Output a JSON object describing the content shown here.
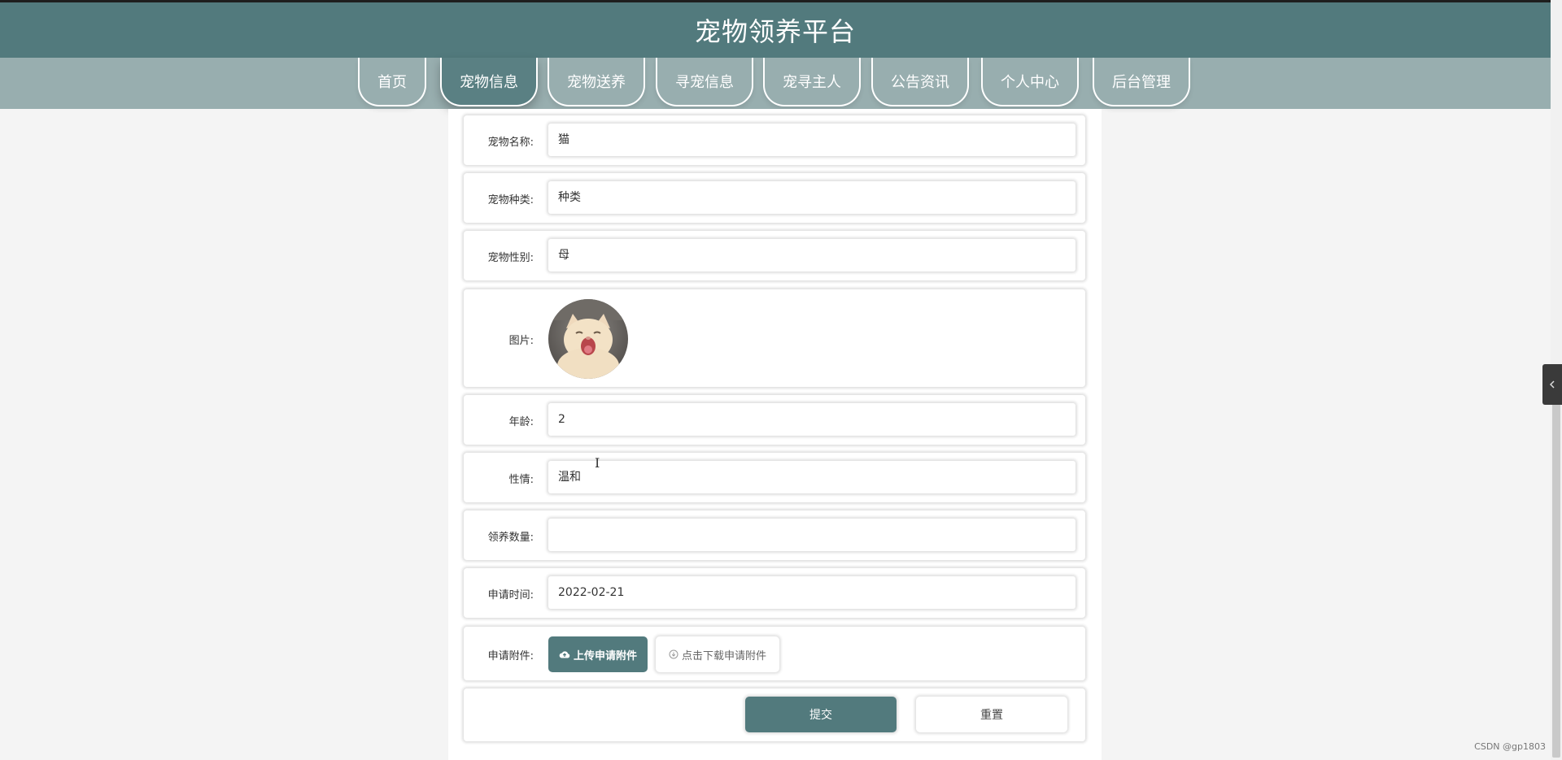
{
  "site": {
    "title": "宠物领养平台"
  },
  "nav": {
    "items": [
      {
        "label": "首页"
      },
      {
        "label": "宠物信息"
      },
      {
        "label": "宠物送养"
      },
      {
        "label": "寻宠信息"
      },
      {
        "label": "宠寻主人"
      },
      {
        "label": "公告资讯"
      },
      {
        "label": "个人中心"
      },
      {
        "label": "后台管理"
      }
    ],
    "active": "宠物信息"
  },
  "form": {
    "pet_name": {
      "label": "宠物名称:",
      "value": "猫"
    },
    "pet_kind": {
      "label": "宠物种类:",
      "value": "种类"
    },
    "pet_gender": {
      "label": "宠物性别:",
      "value": "母"
    },
    "picture": {
      "label": "图片:"
    },
    "age": {
      "label": "年龄:",
      "value": "2"
    },
    "temper": {
      "label": "性情:",
      "value": "温和"
    },
    "adopt_count": {
      "label": "领养数量:",
      "value": ""
    },
    "apply_time": {
      "label": "申请时间:",
      "value": "2022-02-21"
    },
    "attachment": {
      "label": "申请附件:",
      "upload_label": "上传申请附件",
      "download_label": "点击下载申请附件"
    },
    "submit_label": "提交",
    "reset_label": "重置"
  },
  "icons": {
    "upload": "cloud-upload-icon",
    "download": "download-circle-icon",
    "side_toggle": "chevron-left-icon"
  },
  "colors": {
    "primary": "#527a7d",
    "nav_bg": "#98aeaf",
    "panel_bg": "#ffffff"
  },
  "watermark": "CSDN @gp1803"
}
